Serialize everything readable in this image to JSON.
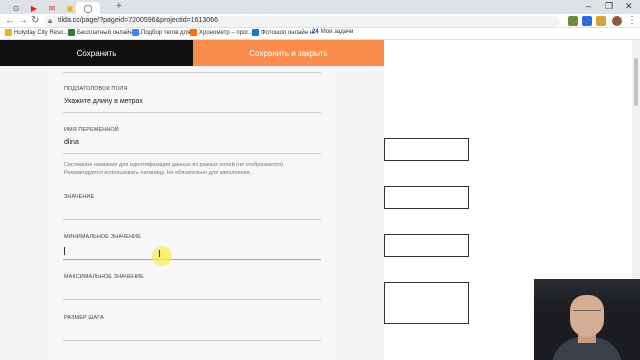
{
  "browser": {
    "url": "tilda.cc/page/?pageid=7200596&projectid=1613066"
  },
  "bookmarks": [
    {
      "label": "Holyday City Reso...",
      "color": "#f2b01e"
    },
    {
      "label": "Бесплатный онлайн к...",
      "color": "#2e7d32"
    },
    {
      "label": "Подбор тегов для...",
      "color": "#4285f4"
    },
    {
      "label": "Хронометр – прог...",
      "color": "#ff6f00"
    },
    {
      "label": "Фотошоп онлайн н...",
      "color": "#1976d2"
    },
    {
      "label": "Мои задачи",
      "color": "#0d47a1",
      "prefix": "24"
    }
  ],
  "toolbar": {
    "save_label": "Сохранить",
    "save_close_label": "Сохранить и закрыть"
  },
  "form": {
    "subtitle_label": "ПОДЗАГОЛОВОК ПОЛЯ",
    "subtitle_value": "Укажите длину в метрах",
    "variable_label": "ИМЯ ПЕРЕМЕННОЙ",
    "variable_value": "dlina",
    "variable_hint": "Системное название для идентификации данных из разных полей (не отображается). Рекомендуется использовать латиницу. Не обязательно для заполнения.",
    "value_label": "ЗНАЧЕНИЕ",
    "value_value": "",
    "min_label": "МИНИМАЛЬНОЕ ЗНАЧЕНИЕ",
    "min_value": "",
    "max_label": "МАКСИМАЛЬНОЕ ЗНАЧЕНИЕ",
    "max_value": "",
    "step_label": "РАЗМЕР ШАГА",
    "step_value": ""
  },
  "colors": {
    "accent": "#fa8c4c",
    "dark_button": "#111111"
  }
}
